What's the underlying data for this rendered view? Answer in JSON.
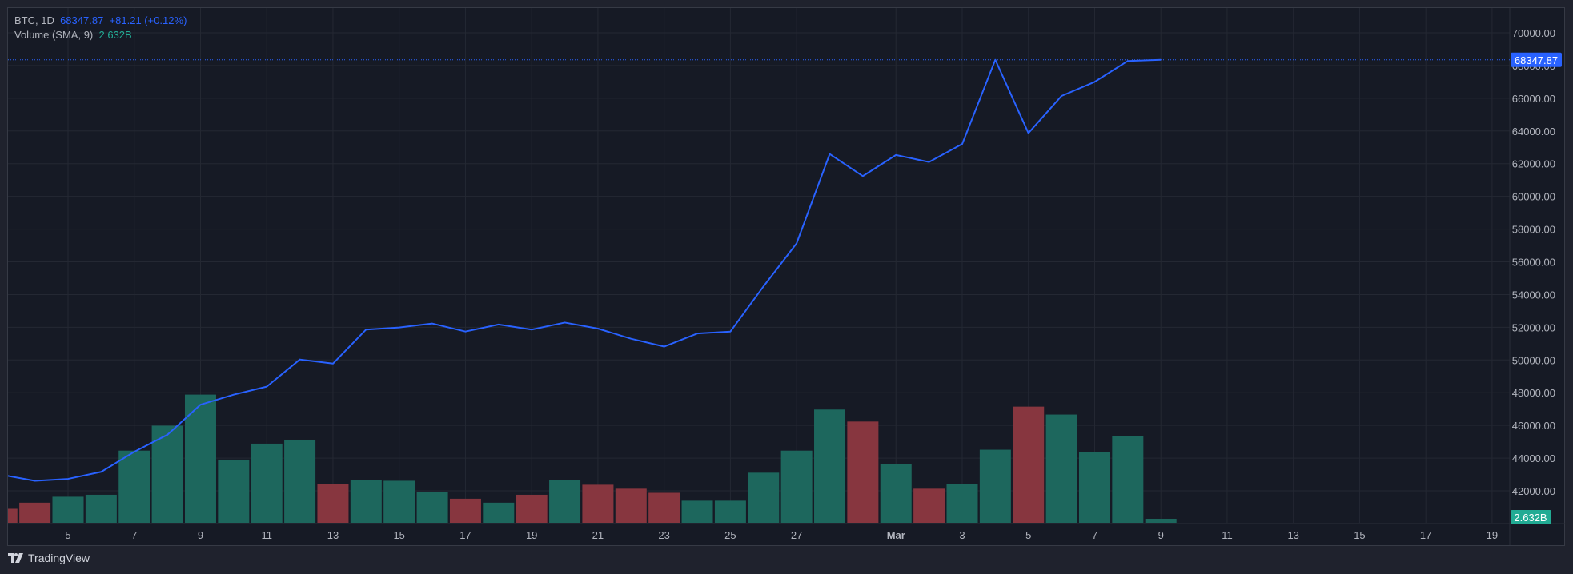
{
  "legend": {
    "symbol": "BTC, 1D",
    "last": "68347.87",
    "change": "+81.21 (+0.12%)",
    "volume_label": "Volume (SMA, 9)",
    "volume_value": "2.632B"
  },
  "branding": {
    "name": "TradingView"
  },
  "colors": {
    "line": "#2962ff",
    "up": "#1d675d",
    "down": "#87363f",
    "grid": "#242833",
    "axis_text": "#b2b5be",
    "volume_badge": "#22ab94"
  },
  "chart_data": {
    "type": "line",
    "title": "BTC, 1D",
    "price_badge": "68347.87",
    "volume_badge": "2.632B",
    "ylim": [
      41000,
      71000
    ],
    "y_ticks": [
      "42000.00",
      "44000.00",
      "46000.00",
      "48000.00",
      "50000.00",
      "52000.00",
      "54000.00",
      "56000.00",
      "58000.00",
      "60000.00",
      "62000.00",
      "64000.00",
      "66000.00",
      "68000.00",
      "70000.00"
    ],
    "x_ticks": [
      {
        "day": 5,
        "label": "5"
      },
      {
        "day": 7,
        "label": "7"
      },
      {
        "day": 9,
        "label": "9"
      },
      {
        "day": 11,
        "label": "11"
      },
      {
        "day": 13,
        "label": "13"
      },
      {
        "day": 15,
        "label": "15"
      },
      {
        "day": 17,
        "label": "17"
      },
      {
        "day": 19,
        "label": "19"
      },
      {
        "day": 21,
        "label": "21"
      },
      {
        "day": 23,
        "label": "23"
      },
      {
        "day": 25,
        "label": "25"
      },
      {
        "day": 27,
        "label": "27"
      },
      {
        "day": 30,
        "label": "Mar"
      },
      {
        "day": 32,
        "label": "3"
      },
      {
        "day": 34,
        "label": "5"
      },
      {
        "day": 36,
        "label": "7"
      },
      {
        "day": 38,
        "label": "9"
      },
      {
        "day": 40,
        "label": "11"
      },
      {
        "day": 42,
        "label": "13"
      },
      {
        "day": 44,
        "label": "15"
      },
      {
        "day": 46,
        "label": "17"
      },
      {
        "day": 48,
        "label": "19"
      }
    ],
    "series": [
      {
        "name": "BTC close",
        "type": "line",
        "x": [
          "Feb 3",
          "Feb 4",
          "Feb 5",
          "Feb 6",
          "Feb 7",
          "Feb 8",
          "Feb 9",
          "Feb 10",
          "Feb 11",
          "Feb 12",
          "Feb 13",
          "Feb 14",
          "Feb 15",
          "Feb 16",
          "Feb 17",
          "Feb 18",
          "Feb 19",
          "Feb 20",
          "Feb 21",
          "Feb 22",
          "Feb 23",
          "Feb 24",
          "Feb 25",
          "Feb 26",
          "Feb 27",
          "Feb 28",
          "Feb 29",
          "Mar 1",
          "Mar 2",
          "Mar 3",
          "Mar 4",
          "Mar 5",
          "Mar 6",
          "Mar 7",
          "Mar 8",
          "Mar 9"
        ],
        "values": [
          42980,
          42610,
          42730,
          43160,
          44390,
          45430,
          47270,
          47880,
          48370,
          50030,
          49780,
          51860,
          51990,
          52230,
          51740,
          52170,
          51860,
          52290,
          51920,
          51300,
          50820,
          51620,
          51740,
          54500,
          57130,
          62590,
          61240,
          62530,
          62100,
          63200,
          68350,
          63870,
          66140,
          67000,
          68280,
          68347.87
        ]
      },
      {
        "name": "Volume (B)",
        "type": "bar",
        "values": [
          9.2,
          13.2,
          17.1,
          18.4,
          47.4,
          63.8,
          84.2,
          41.5,
          52.0,
          54.6,
          25.7,
          28.3,
          27.6,
          20.4,
          15.8,
          13.2,
          18.4,
          28.3,
          25.0,
          22.4,
          19.7,
          14.5,
          14.5,
          32.9,
          47.4,
          74.4,
          66.5,
          38.8,
          22.4,
          25.7,
          48.0,
          76.3,
          71.1,
          46.7,
          57.2,
          2.632
        ],
        "direction": [
          "down",
          "down",
          "up",
          "up",
          "up",
          "up",
          "up",
          "up",
          "up",
          "up",
          "down",
          "up",
          "up",
          "up",
          "down",
          "up",
          "down",
          "up",
          "down",
          "down",
          "down",
          "up",
          "up",
          "up",
          "up",
          "up",
          "down",
          "up",
          "down",
          "up",
          "up",
          "down",
          "up",
          "up",
          "up",
          "up"
        ]
      }
    ]
  }
}
